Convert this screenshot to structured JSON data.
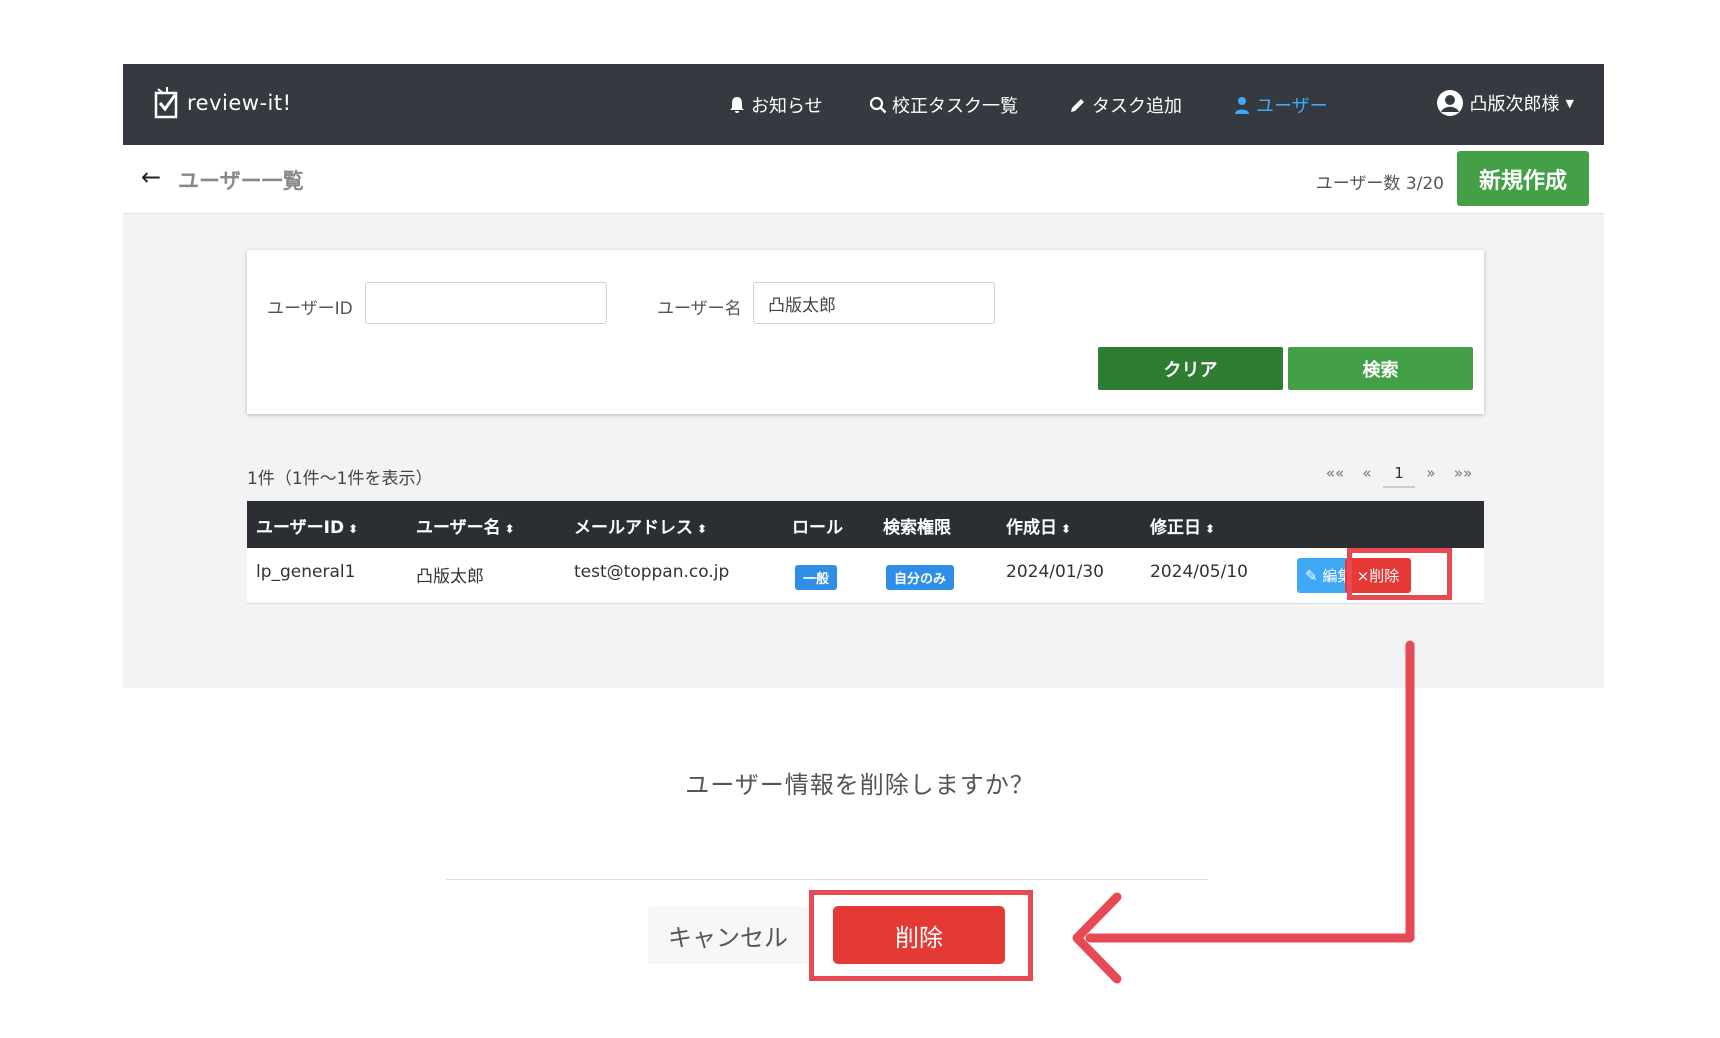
{
  "navbar": {
    "brand": "review-it!",
    "items": [
      {
        "label": "お知らせ",
        "icon": "bell-icon"
      },
      {
        "label": "校正タスク一覧",
        "icon": "search-icon"
      },
      {
        "label": "タスク追加",
        "icon": "pencil-icon"
      },
      {
        "label": "ユーザー",
        "icon": "user-icon",
        "active": true
      }
    ],
    "user_name": "凸版次郎様"
  },
  "subheader": {
    "title": "ユーザー一覧",
    "user_count": "ユーザー数 3/20",
    "new_button": "新規作成"
  },
  "search": {
    "user_id_label": "ユーザーID",
    "user_id_value": "",
    "user_name_label": "ユーザー名",
    "user_name_value": "凸版太郎",
    "clear_button": "クリア",
    "search_button": "検索"
  },
  "results": {
    "info": "1件（1件〜1件を表示）",
    "pager": [
      "««",
      "«",
      "1",
      "»",
      "»»"
    ]
  },
  "table": {
    "headers": [
      "ユーザーID",
      "ユーザー名",
      "メールアドレス",
      "ロール",
      "検索権限",
      "作成日",
      "修正日"
    ],
    "rows": [
      {
        "user_id": "lp_general1",
        "user_name": "凸版太郎",
        "email": "test@toppan.co.jp",
        "role": "一般",
        "search_scope": "自分のみ",
        "created": "2024/01/30",
        "modified": "2024/05/10",
        "edit_label": "編集",
        "delete_label": "×削除"
      }
    ]
  },
  "dialog": {
    "message": "ユーザー情報を削除しますか？",
    "cancel": "キャンセル",
    "confirm": "削除"
  },
  "colors": {
    "navbar": "#343a40",
    "accent_green": "#43a047",
    "dark_green": "#2e7d32",
    "danger": "#e53935",
    "info_blue": "#3fa9f5",
    "annotation_red": "#e84a55"
  }
}
